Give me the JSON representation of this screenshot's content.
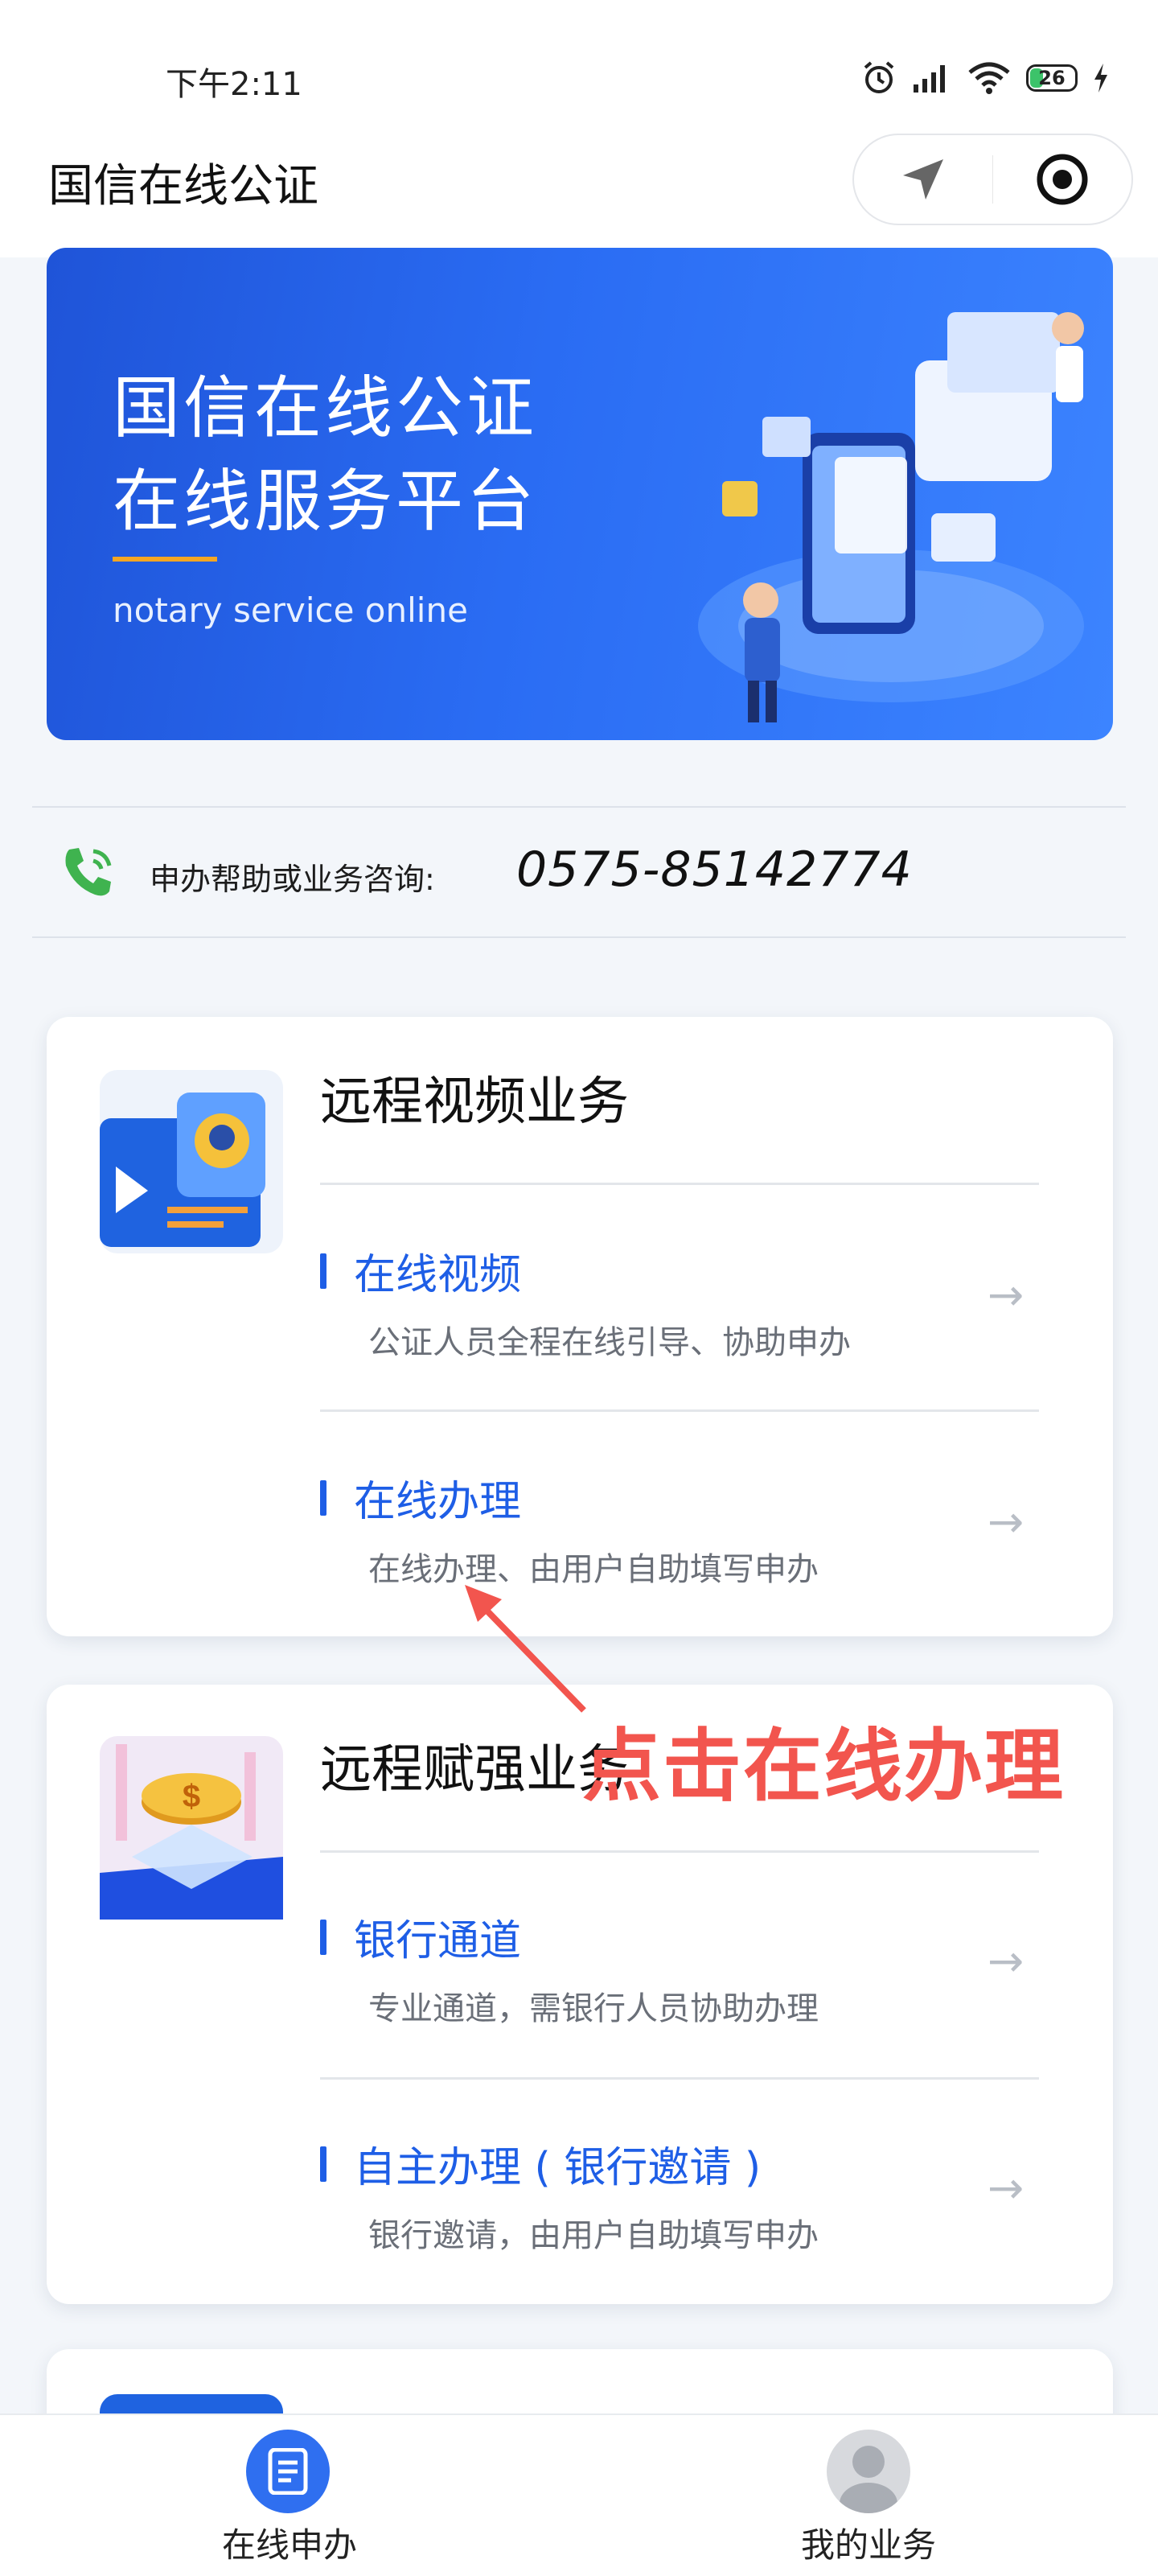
{
  "status_bar": {
    "time": "下午2:11",
    "battery": "26"
  },
  "header": {
    "title": "国信在线公证"
  },
  "banner": {
    "title_line1": "国信在线公证",
    "title_line2": "在线服务平台",
    "subtitle": "notary service online"
  },
  "consult": {
    "label": "申办帮助或业务咨询:",
    "phone": "0575-85142774"
  },
  "sections": [
    {
      "title": "远程视频业务",
      "items": [
        {
          "title": "在线视频",
          "desc": "公证人员全程在线引导、协助申办"
        },
        {
          "title": "在线办理",
          "desc": "在线办理、由用户自助填写申办"
        }
      ]
    },
    {
      "title": "远程赋强业务",
      "items": [
        {
          "title": "银行通道",
          "desc": "专业通道，需银行人员协助办理"
        },
        {
          "title": "自主办理 ( 银行邀请 )",
          "desc": "银行邀请，由用户自助填写申办"
        }
      ]
    }
  ],
  "annotation": {
    "text": "点击在线办理"
  },
  "tabbar": {
    "tabs": [
      {
        "label": "在线申办"
      },
      {
        "label": "我的业务"
      }
    ]
  },
  "colors": {
    "accent": "#1e5ee6",
    "banner": "#2a6cf3",
    "annotation": "#f2554e"
  }
}
